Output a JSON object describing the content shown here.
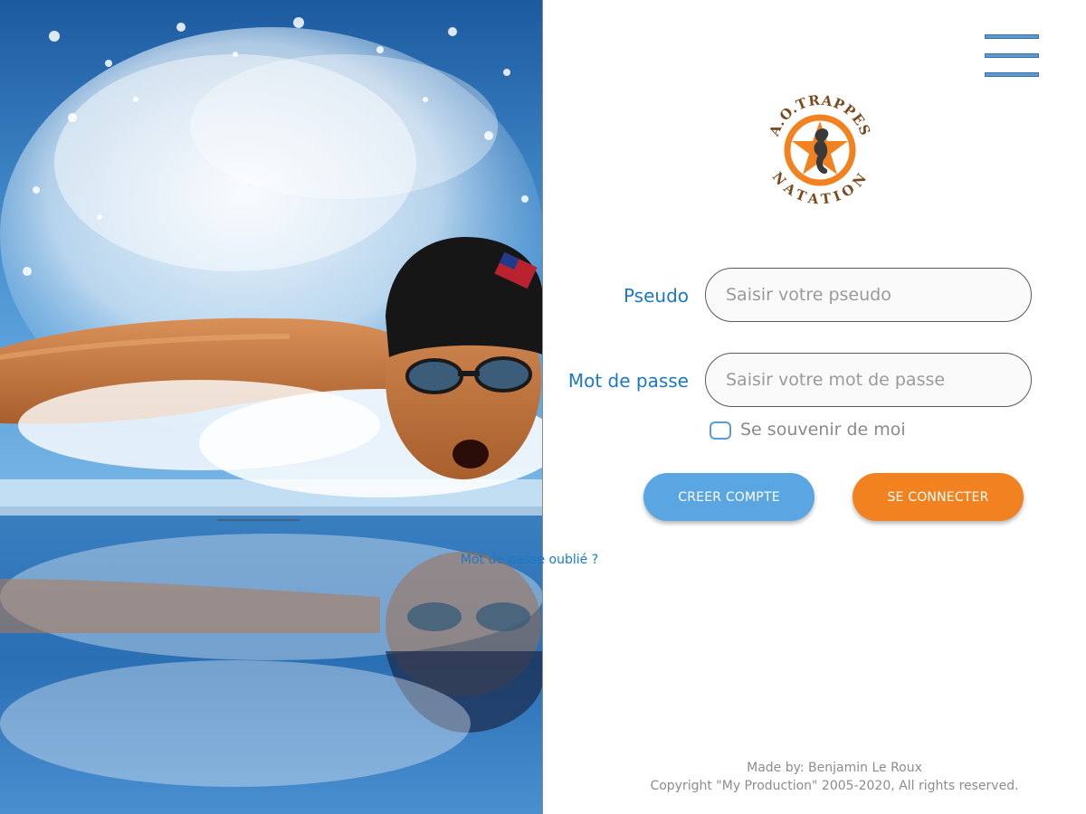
{
  "hero": {
    "image_name": "swimmer-butterfly-photo",
    "colors": {
      "water_deep": "#1d5fa3",
      "water_light": "#6aaee0",
      "skin": "#c9824a",
      "cap": "#161616"
    }
  },
  "menu": {
    "icon": "hamburger-menu-icon",
    "color": "#5b9bd5"
  },
  "logo": {
    "text_top": "A.O.TRAPPES",
    "text_bottom": "NATATION",
    "icon": "seahorse-star-logo",
    "colors": {
      "ring": "#f2811f",
      "text": "#7a4a1e",
      "seahorse": "#3a3a3a"
    }
  },
  "form": {
    "username": {
      "label": "Pseudo",
      "placeholder": "Saisir votre pseudo",
      "value": ""
    },
    "password": {
      "label": "Mot de passe",
      "placeholder": "Saisir votre mot de passe",
      "value": ""
    },
    "remember": {
      "label": "Se souvenir de moi",
      "checked": false
    },
    "buttons": {
      "create": "CREER COMPTE",
      "login": "SE CONNECTER"
    },
    "forgot": "Mot de passe oublié ?"
  },
  "footer": {
    "made_by": "Made by: Benjamin Le Roux",
    "copyright": "Copyright \"My Production\" 2005-2020, All rights reserved."
  },
  "colors": {
    "accent_blue": "#1b78c8",
    "button_blue": "#5aa6e3",
    "button_orange": "#f2811f"
  }
}
